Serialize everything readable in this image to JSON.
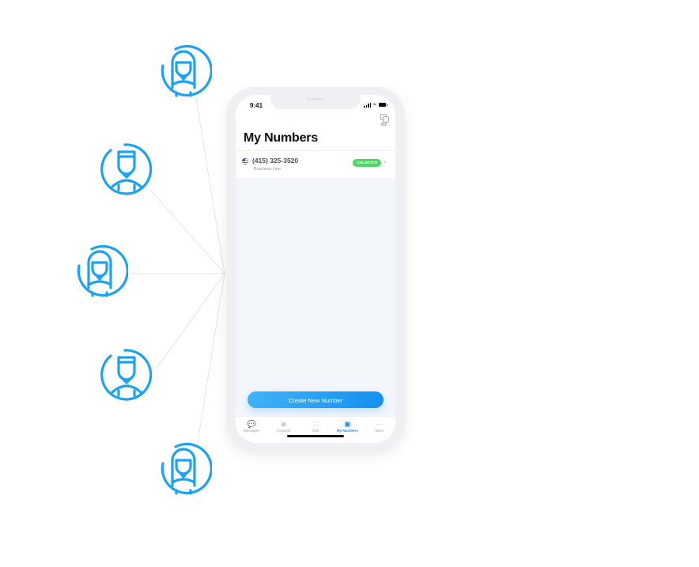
{
  "colors": {
    "accent": "#1e8ef0",
    "avatar": "#1aa3f5",
    "badge": "#4cd964",
    "connector": "#dcdcdc"
  },
  "avatars": [
    {
      "icon": "female-user-icon",
      "label": "user-1"
    },
    {
      "icon": "male-user-icon",
      "label": "user-2"
    },
    {
      "icon": "female-user-icon",
      "label": "user-3"
    },
    {
      "icon": "male-user-icon",
      "label": "user-4"
    },
    {
      "icon": "female-user-icon",
      "label": "user-5"
    }
  ],
  "status_bar": {
    "time": "9:41"
  },
  "header": {
    "title": "My Numbers",
    "credits_icon": "coins-icon",
    "credits": "450"
  },
  "numbers": [
    {
      "flag": "us-flag-icon",
      "number": "(415) 325-3520",
      "type": "Business Line",
      "badge": "UNLIMITED"
    }
  ],
  "create_button": "Create New Number",
  "tabs": [
    {
      "label": "Messages",
      "icon": "messages-icon",
      "active": false
    },
    {
      "label": "Contacts",
      "icon": "contacts-icon",
      "active": false
    },
    {
      "label": "Dial",
      "icon": "dialpad-icon",
      "active": false
    },
    {
      "label": "My Numbers",
      "icon": "my-numbers-icon",
      "active": true
    },
    {
      "label": "More",
      "icon": "more-icon",
      "active": false
    }
  ]
}
